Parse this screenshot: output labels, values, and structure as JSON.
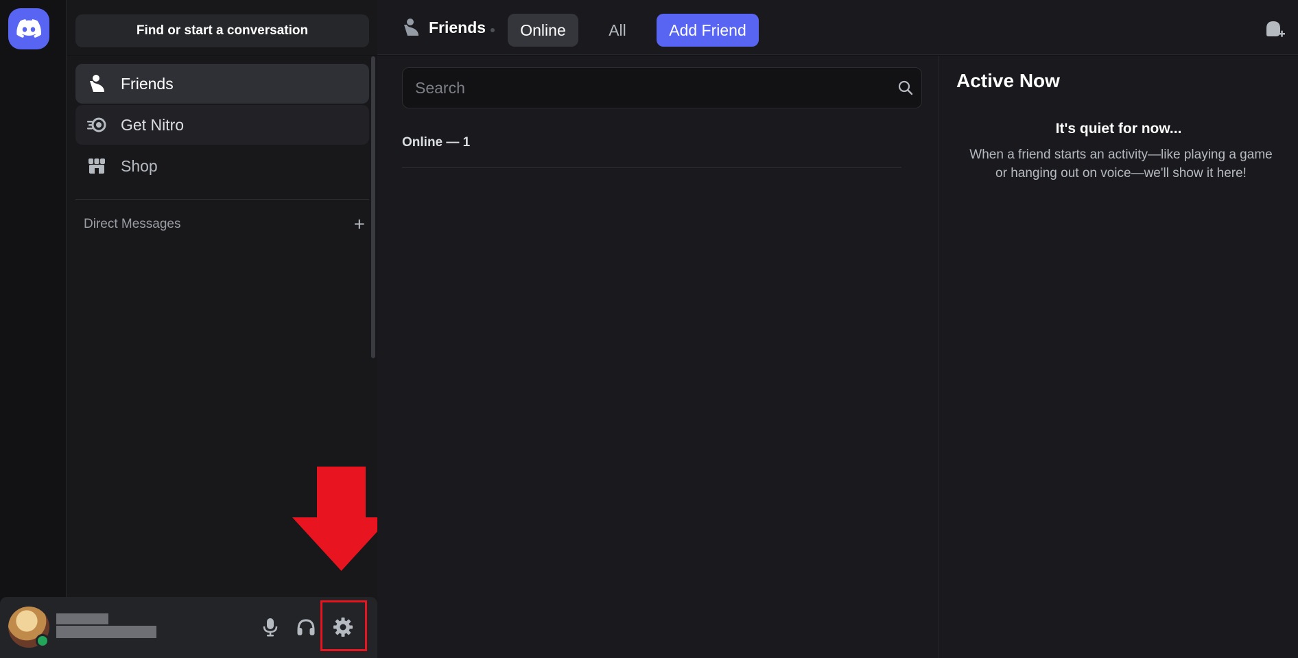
{
  "rail": {
    "home_icon": "discord-logo-icon"
  },
  "sidebar": {
    "find_label": "Find or start a conversation",
    "items": [
      {
        "label": "Friends",
        "icon": "friends-icon"
      },
      {
        "label": "Get Nitro",
        "icon": "nitro-icon"
      },
      {
        "label": "Shop",
        "icon": "shop-icon"
      }
    ],
    "dm_header": "Direct Messages",
    "dm_add_icon": "plus-icon"
  },
  "user_panel": {
    "status_color": "#23a55a",
    "icons": [
      "microphone-icon",
      "headphones-icon",
      "gear-icon"
    ]
  },
  "annotation": {
    "color": "#e8141f",
    "target": "gear-icon"
  },
  "topbar": {
    "title": "Friends",
    "tabs": {
      "online": "Online",
      "all": "All",
      "add_friend": "Add Friend"
    },
    "new_group_icon": "new-group-dm-icon"
  },
  "main": {
    "search_placeholder": "Search",
    "online_count": "Online — 1"
  },
  "active_now": {
    "title": "Active Now",
    "empty_title": "It's quiet for now...",
    "empty_desc": "When a friend starts an activity—like playing a game or hanging out on voice—we'll show it here!"
  },
  "colors": {
    "accent": "#5865f2",
    "background": "#1a1a1e",
    "sidebar": "#18181b"
  }
}
